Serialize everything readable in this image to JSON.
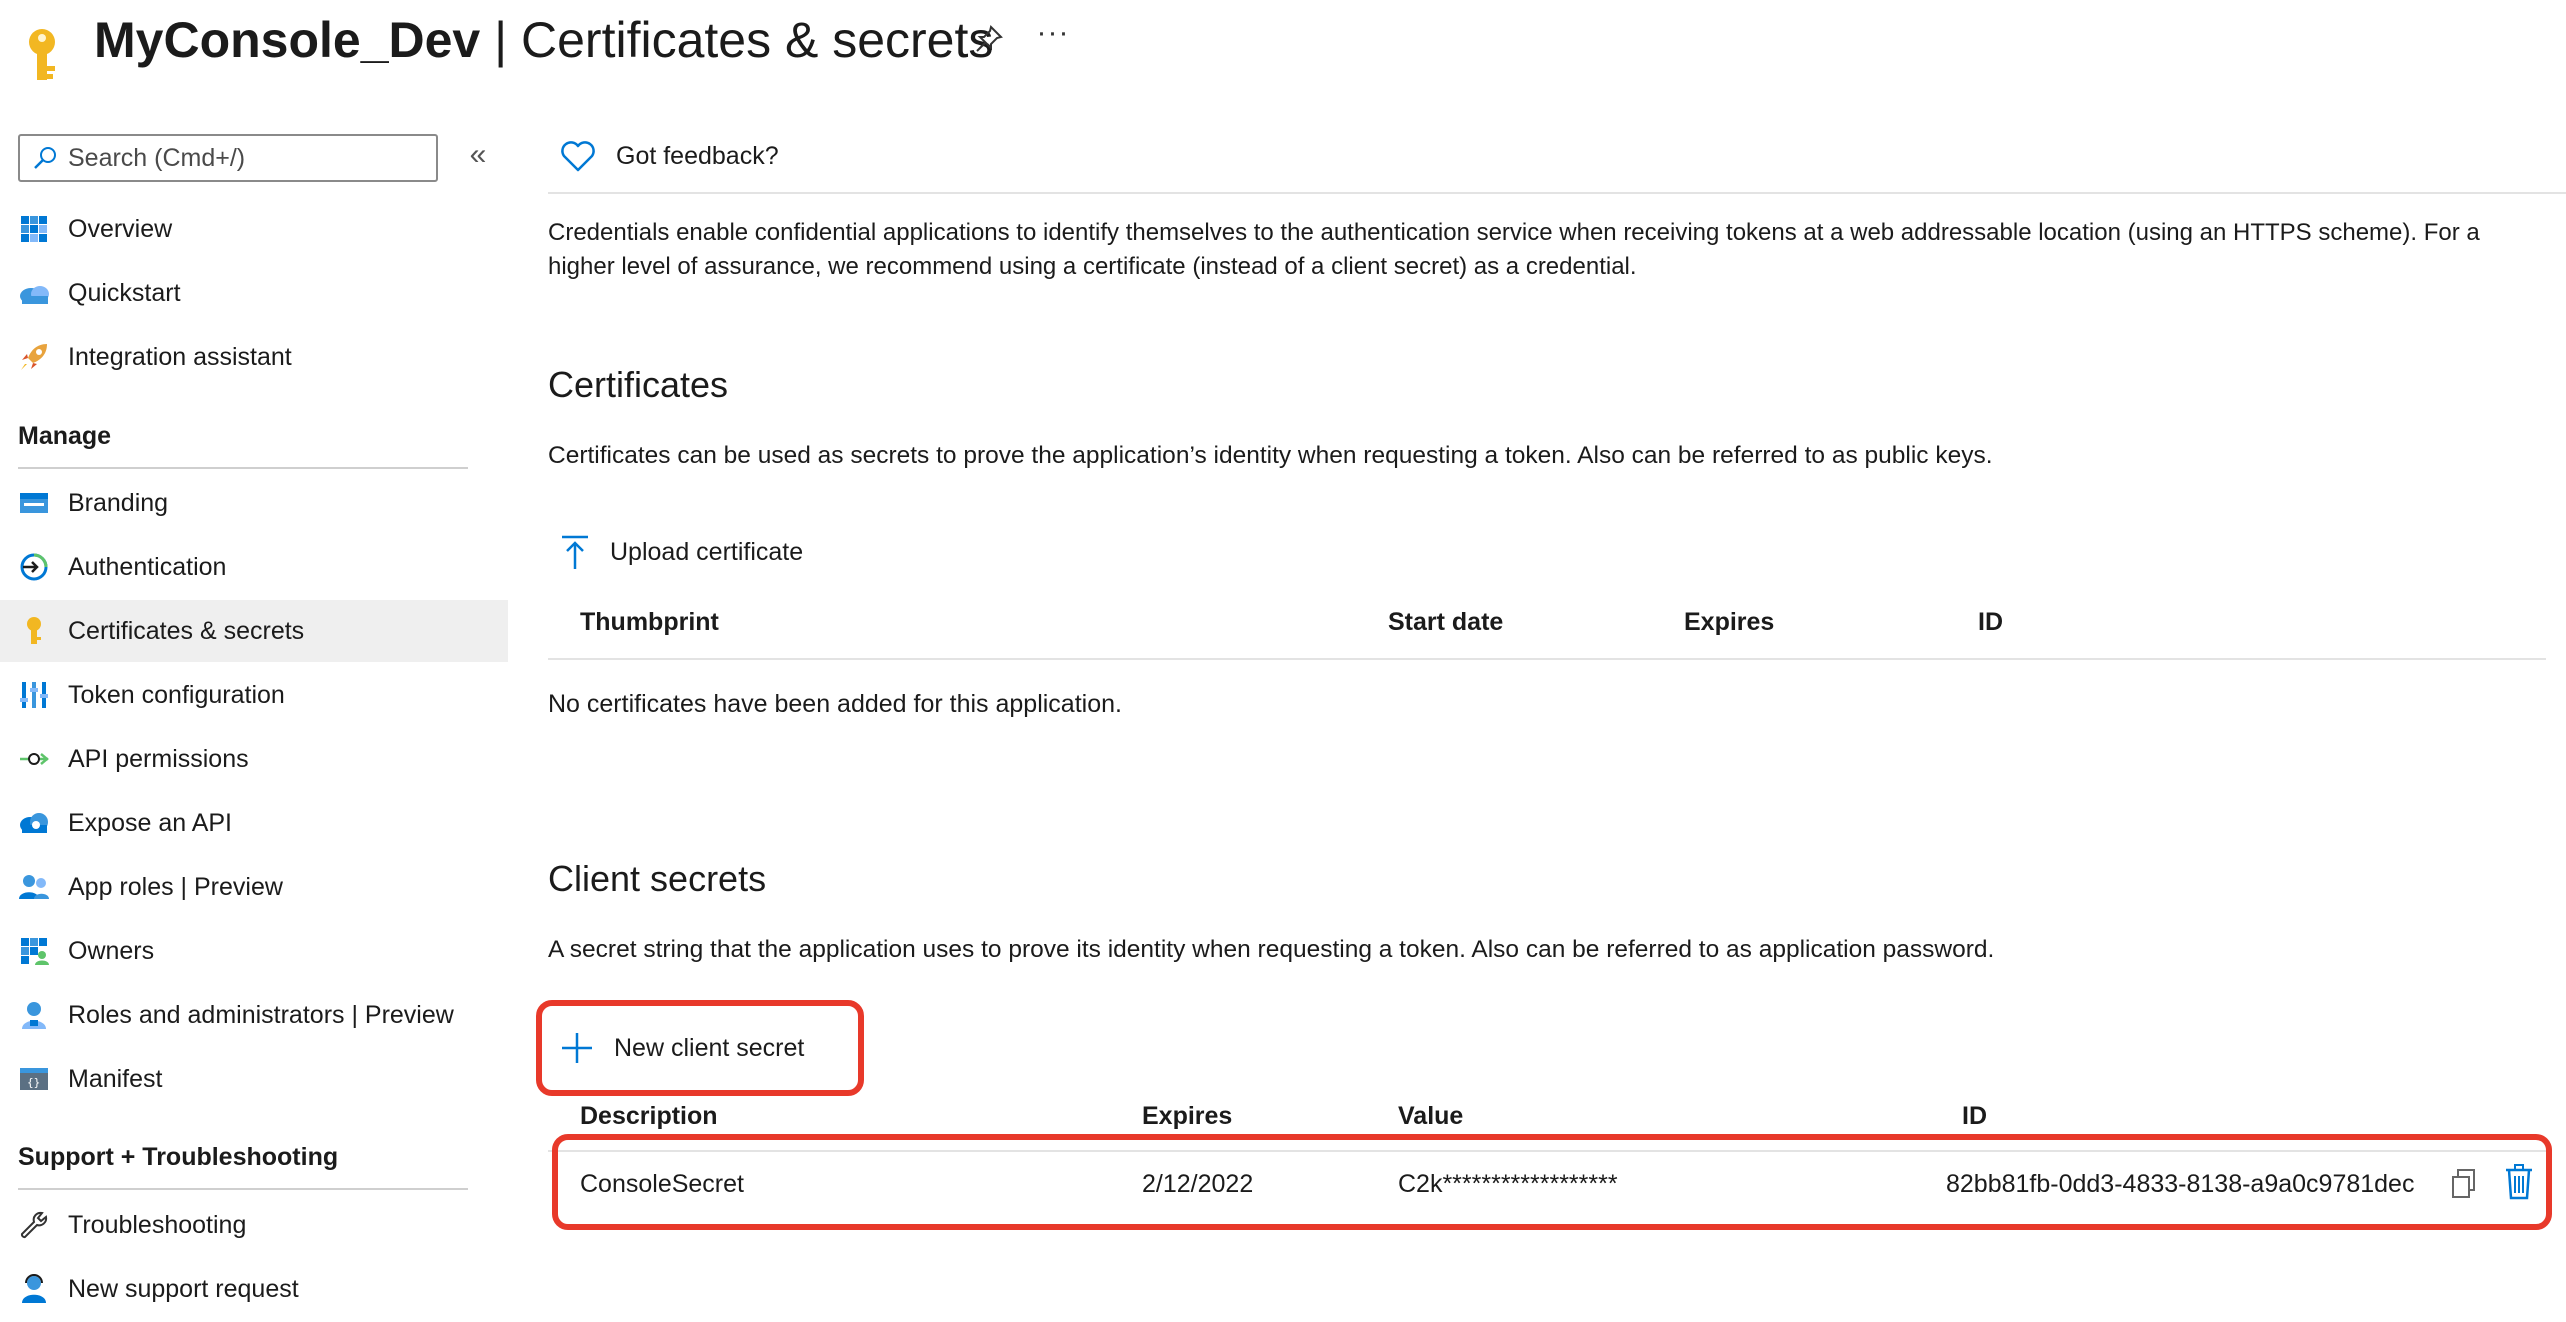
{
  "header": {
    "app_name": "MyConsole_Dev",
    "separator": " | ",
    "blade_title": "Certificates & secrets",
    "pin_icon": "pin-icon",
    "more_label": "···"
  },
  "sidebar": {
    "search_placeholder": "Search (Cmd+/)",
    "collapse_label": "«",
    "top_items": [
      {
        "label": "Overview",
        "icon": "grid-icon"
      },
      {
        "label": "Quickstart",
        "icon": "cloud-icon"
      },
      {
        "label": "Integration assistant",
        "icon": "rocket-icon"
      }
    ],
    "manage_heading": "Manage",
    "manage_items": [
      {
        "label": "Branding",
        "icon": "branding-icon"
      },
      {
        "label": "Authentication",
        "icon": "authentication-icon"
      },
      {
        "label": "Certificates & secrets",
        "icon": "key-icon",
        "active": true
      },
      {
        "label": "Token configuration",
        "icon": "token-bars-icon"
      },
      {
        "label": "API permissions",
        "icon": "api-arrow-icon"
      },
      {
        "label": "Expose an API",
        "icon": "cloud-api-icon"
      },
      {
        "label": "App roles | Preview",
        "icon": "users-icon"
      },
      {
        "label": "Owners",
        "icon": "owners-grid-icon"
      },
      {
        "label": "Roles and administrators | Preview",
        "icon": "admin-person-icon"
      },
      {
        "label": "Manifest",
        "icon": "manifest-icon"
      }
    ],
    "support_heading": "Support + Troubleshooting",
    "support_items": [
      {
        "label": "Troubleshooting",
        "icon": "wrench-icon"
      },
      {
        "label": "New support request",
        "icon": "support-person-icon"
      }
    ]
  },
  "main": {
    "feedback_label": "Got feedback?",
    "intro": "Credentials enable confidential applications to identify themselves to the authentication service when receiving tokens at a web addressable location (using an HTTPS scheme). For a higher level of assurance, we recommend using a certificate (instead of a client secret) as a credential.",
    "certificates": {
      "title": "Certificates",
      "description": "Certificates can be used as secrets to prove the application’s identity when requesting a token. Also can be referred to as public keys.",
      "upload_label": "Upload certificate",
      "columns": [
        "Thumbprint",
        "Start date",
        "Expires",
        "ID"
      ],
      "empty_message": "No certificates have been added for this application."
    },
    "client_secrets": {
      "title": "Client secrets",
      "description": "A secret string that the application uses to prove its identity when requesting a token. Also can be referred to as application password.",
      "new_label": "New client secret",
      "columns": [
        "Description",
        "Expires",
        "Value",
        "ID"
      ],
      "rows": [
        {
          "description": "ConsoleSecret",
          "expires": "2/12/2022",
          "value": "C2k******************",
          "id": "82bb81fb-0dd3-4833-8138-a9a0c9781dec"
        }
      ]
    }
  },
  "colors": {
    "accent_blue": "#0078d4",
    "key_gold": "#f2b722",
    "highlight_red": "#e8392a",
    "active_bg": "#efefef"
  }
}
